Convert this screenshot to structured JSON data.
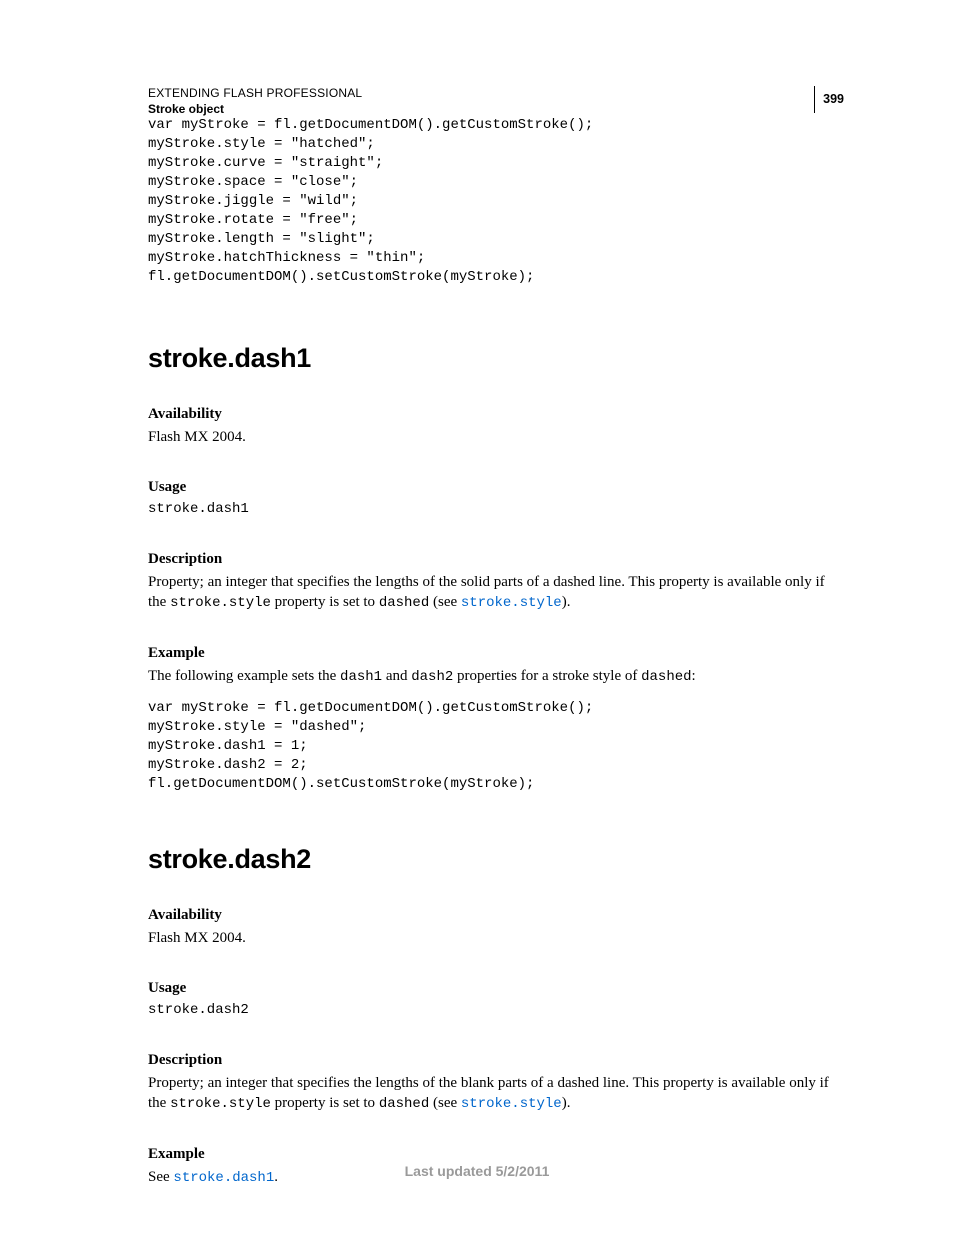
{
  "header": {
    "title": "EXTENDING FLASH PROFESSIONAL",
    "subtitle": "Stroke object",
    "page_number": "399"
  },
  "code_top": "var myStroke = fl.getDocumentDOM().getCustomStroke();\nmyStroke.style = \"hatched\";\nmyStroke.curve = \"straight\";\nmyStroke.space = \"close\";\nmyStroke.jiggle = \"wild\";\nmyStroke.rotate = \"free\";\nmyStroke.length = \"slight\";\nmyStroke.hatchThickness = \"thin\";\nfl.getDocumentDOM().setCustomStroke(myStroke);",
  "sections": {
    "dash1": {
      "heading": "stroke.dash1",
      "availability": {
        "label": "Availability",
        "text": "Flash MX 2004."
      },
      "usage": {
        "label": "Usage",
        "code": "stroke.dash1"
      },
      "description": {
        "label": "Description",
        "pre": "Property; an integer that specifies the lengths of the solid parts of a dashed line. This property is available only if the ",
        "mono1": "stroke.style",
        "mid1": " property is set to ",
        "mono2": "dashed",
        "mid2": " (see ",
        "link": "stroke.style",
        "post": ")."
      },
      "example": {
        "label": "Example",
        "pre": "The following example sets the ",
        "mono1": "dash1",
        "mid1": " and ",
        "mono2": "dash2",
        "mid2": " properties for a stroke style of ",
        "mono3": "dashed",
        "post": ":",
        "code": "var myStroke = fl.getDocumentDOM().getCustomStroke();\nmyStroke.style = \"dashed\";\nmyStroke.dash1 = 1;\nmyStroke.dash2 = 2;\nfl.getDocumentDOM().setCustomStroke(myStroke);"
      }
    },
    "dash2": {
      "heading": "stroke.dash2",
      "availability": {
        "label": "Availability",
        "text": "Flash MX 2004."
      },
      "usage": {
        "label": "Usage",
        "code": "stroke.dash2"
      },
      "description": {
        "label": "Description",
        "pre": "Property; an integer that specifies the lengths of the blank parts of a dashed line. This property is available only if the ",
        "mono1": "stroke.style",
        "mid1": " property is set to ",
        "mono2": "dashed",
        "mid2": " (see ",
        "link": "stroke.style",
        "post": ")."
      },
      "example": {
        "label": "Example",
        "pre": "See ",
        "link": "stroke.dash1",
        "post": "."
      }
    }
  },
  "footer": "Last updated 5/2/2011"
}
